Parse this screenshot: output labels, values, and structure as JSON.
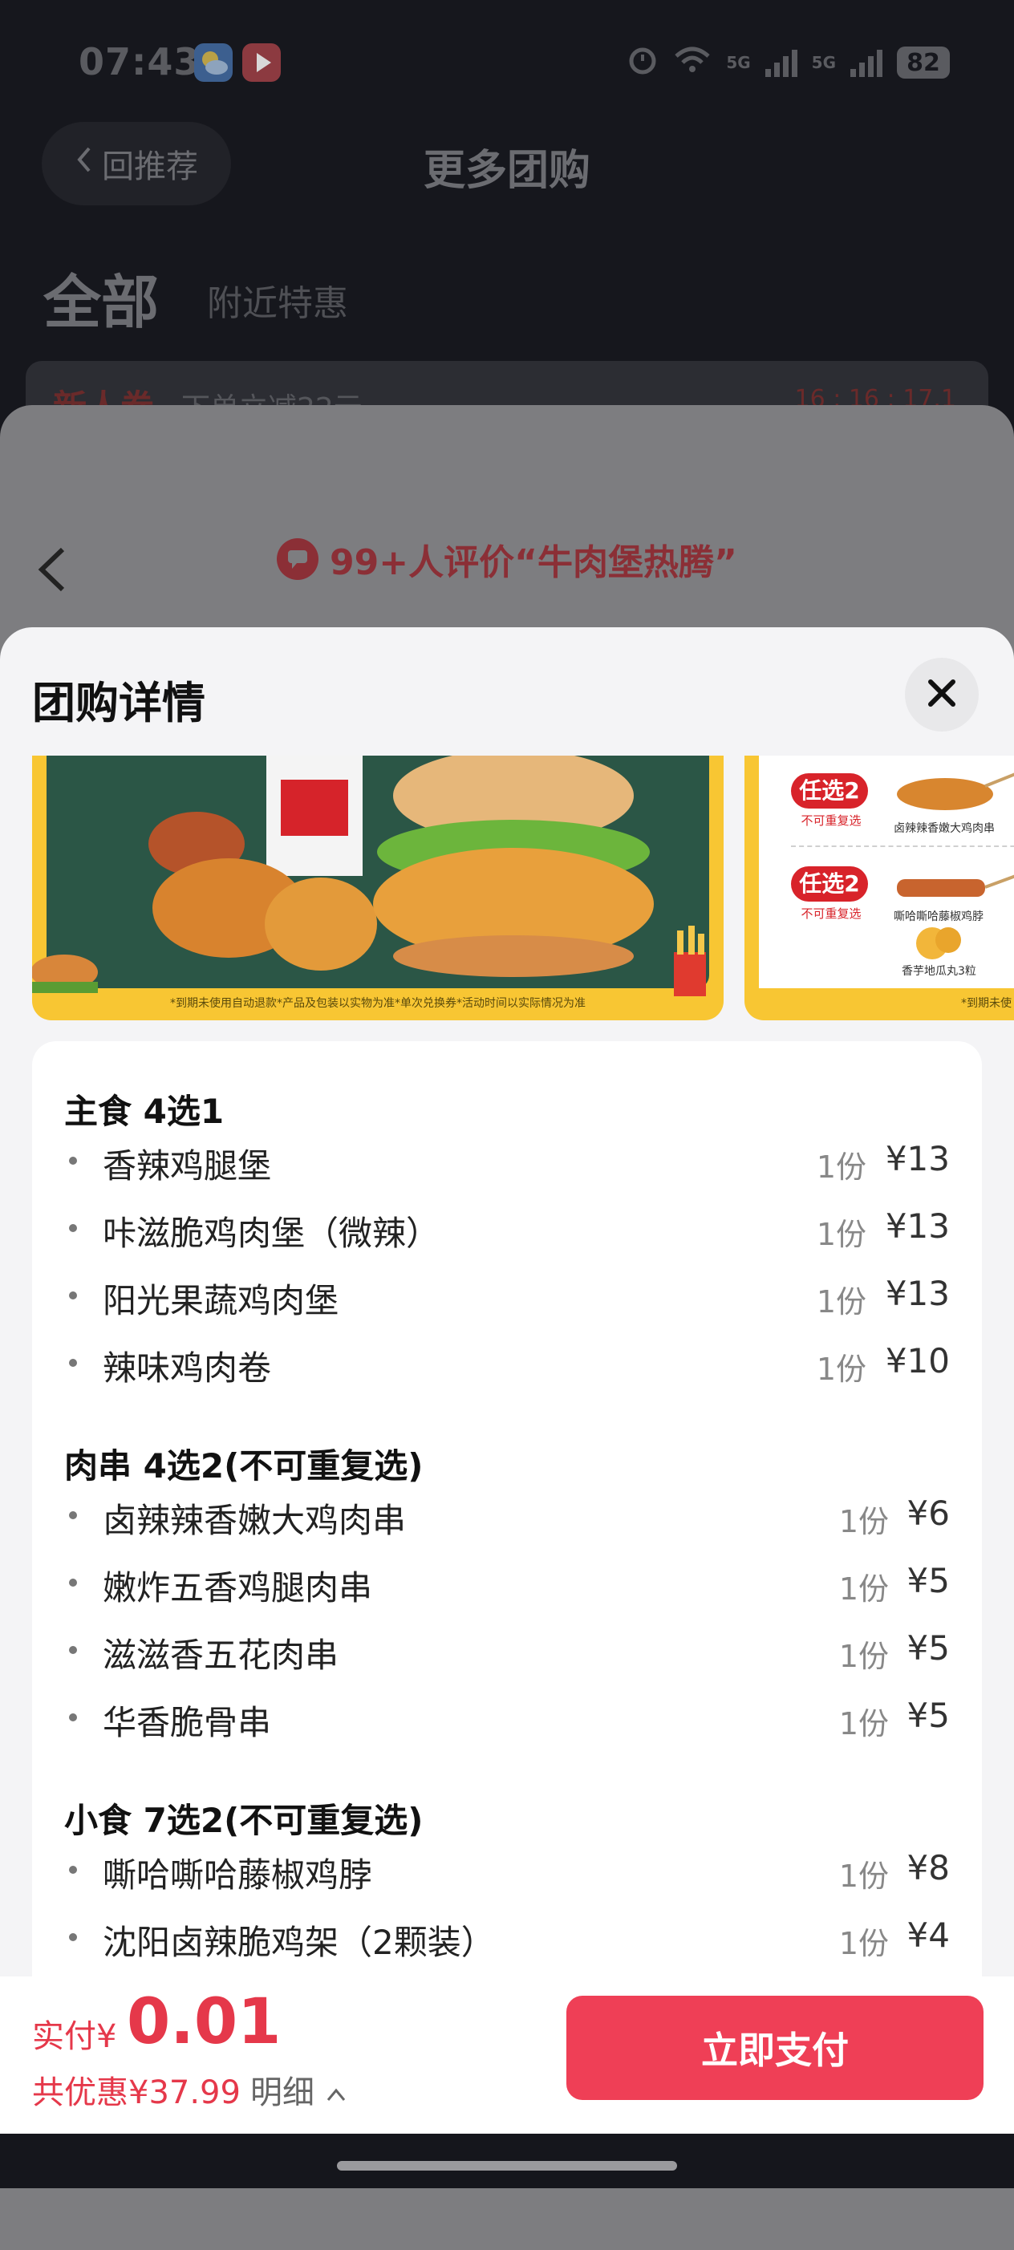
{
  "status_bar": {
    "time": "07:43",
    "battery": "82",
    "network_1": "5G",
    "network_2": "5G",
    "icons": [
      "weather-app-icon",
      "video-app-icon",
      "alarm-icon",
      "wifi-icon",
      "signal-icon",
      "battery-icon"
    ]
  },
  "header": {
    "back_label": "回推荐",
    "title": "更多团购"
  },
  "tabs": {
    "all": "全部",
    "nearby": "附近特惠"
  },
  "coupon": {
    "title": "新人券",
    "subtitle": "下单立减22元",
    "timer": "16 : 16 : 17.1"
  },
  "product": {
    "review_text": "99+人评价“牛肉堡热腾”"
  },
  "sheet": {
    "title": "团购详情"
  },
  "banner": {
    "fine_print": "*到期未使用自动退款*产品及包装以实物为准*单次兑换券*活动时间以实际情况为准",
    "fine_print_2": "*到期未使",
    "pick_badge_1": "任选2",
    "pick_sub_1": "不可重复选",
    "pick_item_1": "卤辣辣香嫩大鸡肉串",
    "pick_badge_2": "任选2",
    "pick_sub_2": "不可重复选",
    "pick_item_2": "嘶哈嘶哈藤椒鸡脖",
    "pick_item_3": "香芋地瓜丸3粒"
  },
  "menu": {
    "sections": [
      {
        "title": "主食 4选1",
        "items": [
          {
            "name": "香辣鸡腿堡",
            "qty": "1份",
            "price": "¥13"
          },
          {
            "name": "咔滋脆鸡肉堡（微辣）",
            "qty": "1份",
            "price": "¥13"
          },
          {
            "name": "阳光果蔬鸡肉堡",
            "qty": "1份",
            "price": "¥13"
          },
          {
            "name": "辣味鸡肉卷",
            "qty": "1份",
            "price": "¥10"
          }
        ]
      },
      {
        "title": "肉串 4选2(不可重复选)",
        "items": [
          {
            "name": "卤辣辣香嫩大鸡肉串",
            "qty": "1份",
            "price": "¥6"
          },
          {
            "name": "嫩炸五香鸡腿肉串",
            "qty": "1份",
            "price": "¥5"
          },
          {
            "name": "滋滋香五花肉串",
            "qty": "1份",
            "price": "¥5"
          },
          {
            "name": "华香脆骨串",
            "qty": "1份",
            "price": "¥5"
          }
        ]
      },
      {
        "title": "小食 7选2(不可重复选)",
        "items": [
          {
            "name": "嘶哈嘶哈藤椒鸡脖",
            "qty": "1份",
            "price": "¥8"
          },
          {
            "name": "沈阳卤辣脆鸡架（2颗装）",
            "qty": "1份",
            "price": "¥4"
          }
        ]
      }
    ]
  },
  "pay": {
    "label": "实付",
    "currency": "¥",
    "amount": "0.01",
    "saving": "共优惠¥37.99",
    "detail": "明细",
    "button": "立即支付"
  },
  "colors": {
    "accent": "#ef3f56",
    "price_red": "#e5384a",
    "banner_yellow": "#f8c633",
    "banner_green": "#2b5646"
  }
}
